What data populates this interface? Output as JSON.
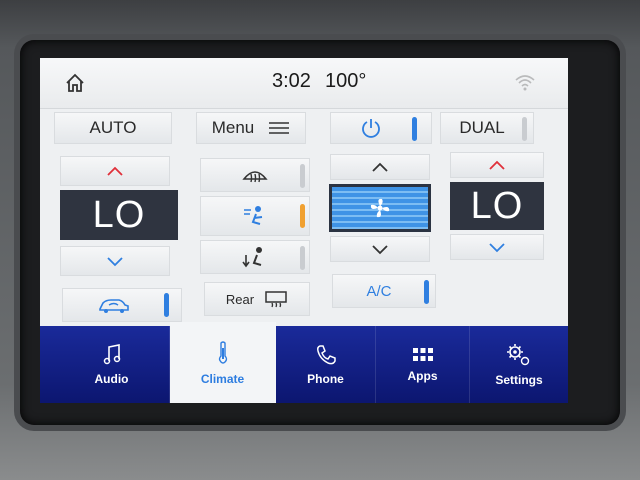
{
  "status_bar": {
    "time": "3:02",
    "outside_temp": "100°"
  },
  "controls": {
    "auto_label": "AUTO",
    "menu_label": "Menu",
    "dual_label": "DUAL",
    "rear_label": "Rear",
    "ac_label": "A/C"
  },
  "driver": {
    "temp": "LO"
  },
  "passenger": {
    "temp": "LO"
  },
  "nav": [
    {
      "label": "Audio",
      "icon": "music-note-icon"
    },
    {
      "label": "Climate",
      "icon": "thermometer-icon"
    },
    {
      "label": "Phone",
      "icon": "phone-icon"
    },
    {
      "label": "Apps",
      "icon": "apps-grid-icon"
    },
    {
      "label": "Settings",
      "icon": "gears-icon"
    }
  ],
  "colors": {
    "accent_blue": "#2f7fe0",
    "active_orange": "#f0a030",
    "up_arrow_red": "#e0303a",
    "nav_background": "#1a2a9a"
  }
}
